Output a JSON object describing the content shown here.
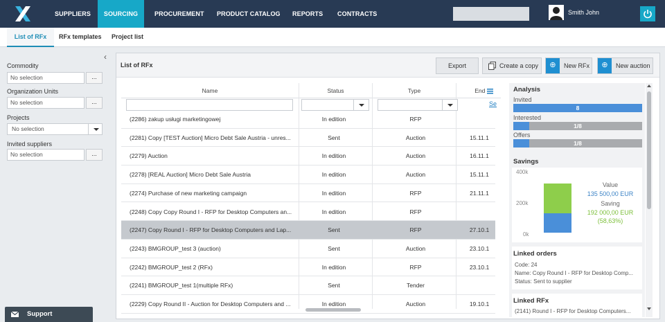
{
  "nav": {
    "items": [
      "SUPPLIERS",
      "SOURCING",
      "PROCUREMENT",
      "PRODUCT CATALOG",
      "REPORTS",
      "CONTRACTS"
    ],
    "active": "SOURCING",
    "user_name": "Smith John"
  },
  "subnav": {
    "items": [
      "List of RFx",
      "RFx templates",
      "Project list"
    ],
    "active": "List of RFx"
  },
  "filters": {
    "commodity_label": "Commodity",
    "commodity_value": "No selection",
    "org_units_label": "Organization Units",
    "org_units_value": "No selection",
    "projects_label": "Projects",
    "projects_value": "No selection",
    "invited_label": "Invited suppliers",
    "invited_value": "No selection",
    "browse_label": "..."
  },
  "support_label": "Support",
  "card": {
    "title": "List of RFx",
    "export_label": "Export",
    "copy_label": "Create a copy",
    "new_rfx_label": "New RFx",
    "new_auction_label": "New auction"
  },
  "table": {
    "columns": [
      "Name",
      "Status",
      "Type",
      "End"
    ],
    "settings_link": "Se",
    "rows": [
      {
        "name": "(2286) zakup usługi marketingowej",
        "status": "In edition",
        "type": "RFP",
        "end": ""
      },
      {
        "name": "(2281) Copy [TEST Auction] Micro Debt Sale Austria - unres...",
        "status": "Sent",
        "type": "Auction",
        "end": "15.11.1"
      },
      {
        "name": "(2279) Auction",
        "status": "In edition",
        "type": "Auction",
        "end": "16.11.1"
      },
      {
        "name": "(2278) [REAL Auction] Micro Debt Sale Austria",
        "status": "In edition",
        "type": "Auction",
        "end": "15.11.1"
      },
      {
        "name": "(2274) Purchase of new marketing campaign",
        "status": "In edition",
        "type": "RFP",
        "end": "21.11.1"
      },
      {
        "name": "(2248) Copy Copy Round I - RFP for Desktop Computers an...",
        "status": "In edition",
        "type": "RFP",
        "end": ""
      },
      {
        "name": "(2247) Copy Round I - RFP for Desktop Computers and Lap...",
        "status": "Sent",
        "type": "RFP",
        "end": "27.10.1"
      },
      {
        "name": "(2243) BMGROUP_test 3 (auction)",
        "status": "Sent",
        "type": "Auction",
        "end": "23.10.1"
      },
      {
        "name": "(2242) BMGROUP_test 2 (RFx)",
        "status": "In edition",
        "type": "RFP",
        "end": "23.10.1"
      },
      {
        "name": "(2241) BMGROUP_test 1(multiple RFx)",
        "status": "Sent",
        "type": "Tender",
        "end": ""
      },
      {
        "name": "(2229) Copy Round II - Auction for Desktop Computers and ...",
        "status": "In edition",
        "type": "Auction",
        "end": "19.10.1"
      }
    ],
    "selected_index": 6
  },
  "analysis": {
    "title": "Analysis",
    "invited_label": "Invited",
    "invited_value": "8",
    "invited_fraction": 1.0,
    "interested_label": "Interested",
    "interested_value": "1/8",
    "interested_fraction": 0.125,
    "offers_label": "Offers",
    "offers_value": "1/8",
    "offers_fraction": 0.125
  },
  "savings": {
    "title": "Savings",
    "y_ticks": [
      "400k",
      "200k",
      "0k"
    ],
    "value_label": "Value",
    "value_amount": "135 500,00 EUR",
    "saving_label": "Saving",
    "saving_amount": "192 000,00 EUR",
    "saving_percent": "(58,63%)"
  },
  "linked_orders": {
    "title": "Linked orders",
    "code": "Code: 24",
    "name": "Name: Copy Round I - RFP for Desktop Comp...",
    "status": "Status: Sent to supplier"
  },
  "linked_rfx": {
    "title": "Linked RFx",
    "item": "(2141) Round I - RFP for Desktop Computers..."
  },
  "colors": {
    "nav_bg": "#283a54",
    "accent": "#17a8c8",
    "primary_button": "#1f8fd1",
    "bar_blue": "#4a8fd9",
    "bar_green": "#8ece4b"
  }
}
